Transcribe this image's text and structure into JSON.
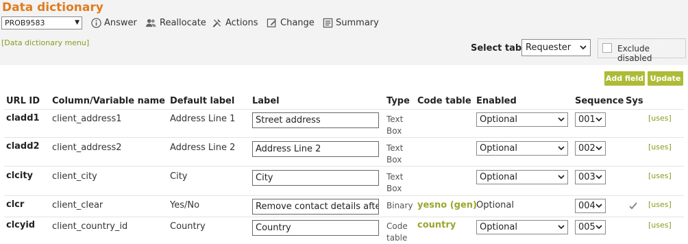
{
  "title": "Data dictionary",
  "prob_select": {
    "value": "PROB9583"
  },
  "toolbar": {
    "answer": "Answer",
    "reallocate": "Reallocate",
    "actions": "Actions",
    "change": "Change",
    "summary": "Summary"
  },
  "dd_menu_link": "[Data dictionary menu]",
  "select_table": {
    "label": "Select table",
    "value": "Requester"
  },
  "exclude_disabled": {
    "label": "Exclude disabled",
    "checked": false
  },
  "buttons": {
    "add_field": "Add field",
    "update": "Update"
  },
  "columns": [
    "URL ID",
    "Column/Variable name",
    "Default label",
    "Label",
    "Type",
    "Code table",
    "Enabled",
    "Sequence",
    "Sys"
  ],
  "rows": [
    {
      "url_id": "cladd1",
      "column": "client_address1",
      "default_label": "Address Line 1",
      "label": "Street address",
      "type_line1": "Text",
      "type_line2": "Box",
      "code_table": "",
      "enabled": "Optional",
      "sequence": "001",
      "sys": "",
      "uses": "[uses]"
    },
    {
      "url_id": "cladd2",
      "column": "client_address2",
      "default_label": "Address Line 2",
      "label": "Address Line 2",
      "type_line1": "Text",
      "type_line2": "Box",
      "code_table": "",
      "enabled": "Optional",
      "sequence": "002",
      "sys": "",
      "uses": "[uses]"
    },
    {
      "url_id": "clcity",
      "column": "client_city",
      "default_label": "City",
      "label": "City",
      "type_line1": "Text",
      "type_line2": "Box",
      "code_table": "",
      "enabled": "Optional",
      "sequence": "003",
      "sys": "",
      "uses": "[uses]"
    },
    {
      "url_id": "clcr",
      "column": "client_clear",
      "default_label": "Yes/No",
      "label": "Remove contact details after clo",
      "type_line1": "Binary",
      "type_line2": "",
      "code_table": "yesno (gen)",
      "enabled": "Optional",
      "sequence": "004",
      "sys": "check",
      "uses": "[uses]"
    },
    {
      "url_id": "clcyid",
      "column": "client_country_id",
      "default_label": "Country",
      "label": "Country",
      "type_line1": "Code",
      "type_line2": "table",
      "code_table": "country",
      "enabled": "Optional",
      "sequence": "005",
      "sys": "",
      "uses": "[uses]"
    }
  ]
}
